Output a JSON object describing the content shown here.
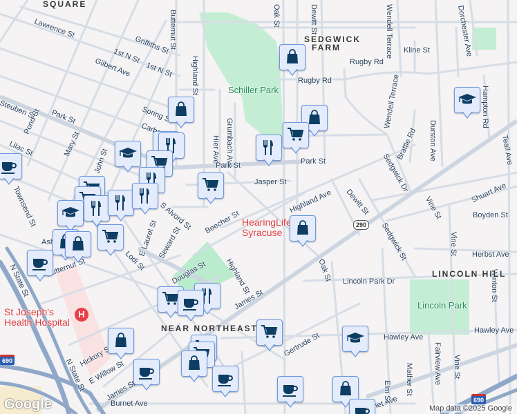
{
  "map": {
    "labels": [
      "SQUARE",
      "Lawrence St",
      "Griffiths St",
      "1st N St",
      "1st N St",
      "Gilbert Ave",
      "Spring St",
      "Park St",
      "Steuben St",
      "Pond St",
      "Lilac St",
      "Mary St",
      "John St",
      "Townsend St",
      "Butternut St",
      "Highland St",
      "Grumbach Ave",
      "Hier Ave",
      "Park St",
      "Oak St",
      "Dewitt St",
      "Wendell Terrace",
      "Kline St",
      "Rugby Rd",
      "Rugby Rd",
      "Wendell Terrace",
      "Dorchester Ave",
      "Hampton Rd",
      "Teall Ave",
      "Durston Ave",
      "Brattle Rd",
      "Sedgwick Dr",
      "Park St",
      "Jasper St",
      "Highland Ave",
      "Dewitt St",
      "Shuart Ave",
      "Vine St",
      "Boyden St",
      "Sedgwick St",
      "Vine St",
      "Herbst Ave",
      "Lincoln Park Dr",
      "Oak St",
      "James St",
      "Highland St",
      "Douglas St",
      "Beecher St",
      "Seward St",
      "E Laurel St",
      "Lodi St",
      "S Alvord St",
      "Butternut St",
      "N State St",
      "Hickory St",
      "N State St",
      "E Willow St",
      "James St",
      "Burnet Ave",
      "Gertrude St",
      "Hawley Ave",
      "Winton St",
      "Fairview Ave",
      "Vine St",
      "Mather St",
      "Elm St",
      "Burnet Ave",
      "Ash",
      "Carbon St",
      "Hawley Ave"
    ],
    "neighborhoods": [
      "SEDGWICK FARM",
      "LINCOLN HILL",
      "NEAR NORTHEAST"
    ],
    "parks": [
      "Schiller Park",
      "Lincoln Park"
    ],
    "pois": [
      "St Joseph's Health Hospital",
      "HearingLife Syracuse"
    ],
    "route_shields": [
      "290",
      "690",
      "690"
    ],
    "attribution": "Map data ©2025 Google",
    "logo": "Google",
    "markers": [
      {
        "icon": "shopping-bag"
      },
      {
        "icon": "shopping-bag"
      },
      {
        "icon": "shopping-bag"
      },
      {
        "icon": "shopping-cart"
      },
      {
        "icon": "restaurant"
      },
      {
        "icon": "restaurant"
      },
      {
        "icon": "restaurant"
      },
      {
        "icon": "graduation-cap"
      },
      {
        "icon": "shopping-cart"
      },
      {
        "icon": "restaurant"
      },
      {
        "icon": "shopping-cart"
      },
      {
        "icon": "coffee"
      },
      {
        "icon": "shopping-cart"
      },
      {
        "icon": "shopping-cart"
      },
      {
        "icon": "restaurant"
      },
      {
        "icon": "restaurant"
      },
      {
        "icon": "restaurant"
      },
      {
        "icon": "graduation-cap"
      },
      {
        "icon": "shopping-bag"
      },
      {
        "icon": "shopping-bag"
      },
      {
        "icon": "shopping-cart"
      },
      {
        "icon": "coffee"
      },
      {
        "icon": "shopping-cart"
      },
      {
        "icon": "restaurant"
      },
      {
        "icon": "coffee"
      },
      {
        "icon": "shopping-bag"
      },
      {
        "icon": "shopping-cart"
      },
      {
        "icon": "graduation-cap"
      },
      {
        "icon": "shopping-bag"
      },
      {
        "icon": "shopping-cart"
      },
      {
        "icon": "shopping-cart"
      },
      {
        "icon": "shopping-bag"
      },
      {
        "icon": "coffee"
      },
      {
        "icon": "coffee"
      },
      {
        "icon": "coffee"
      },
      {
        "icon": "shopping-bag"
      },
      {
        "icon": "coffee"
      },
      {
        "icon": "graduation-cap"
      }
    ],
    "colors": {
      "marker_icon": "#0d3d63",
      "marker_bg": "#e4ecfc",
      "marker_border": "#6c97e0",
      "park": "#bdecd0",
      "hospital_area": "#fbe3e3",
      "highway": "#8fa8c8"
    }
  }
}
